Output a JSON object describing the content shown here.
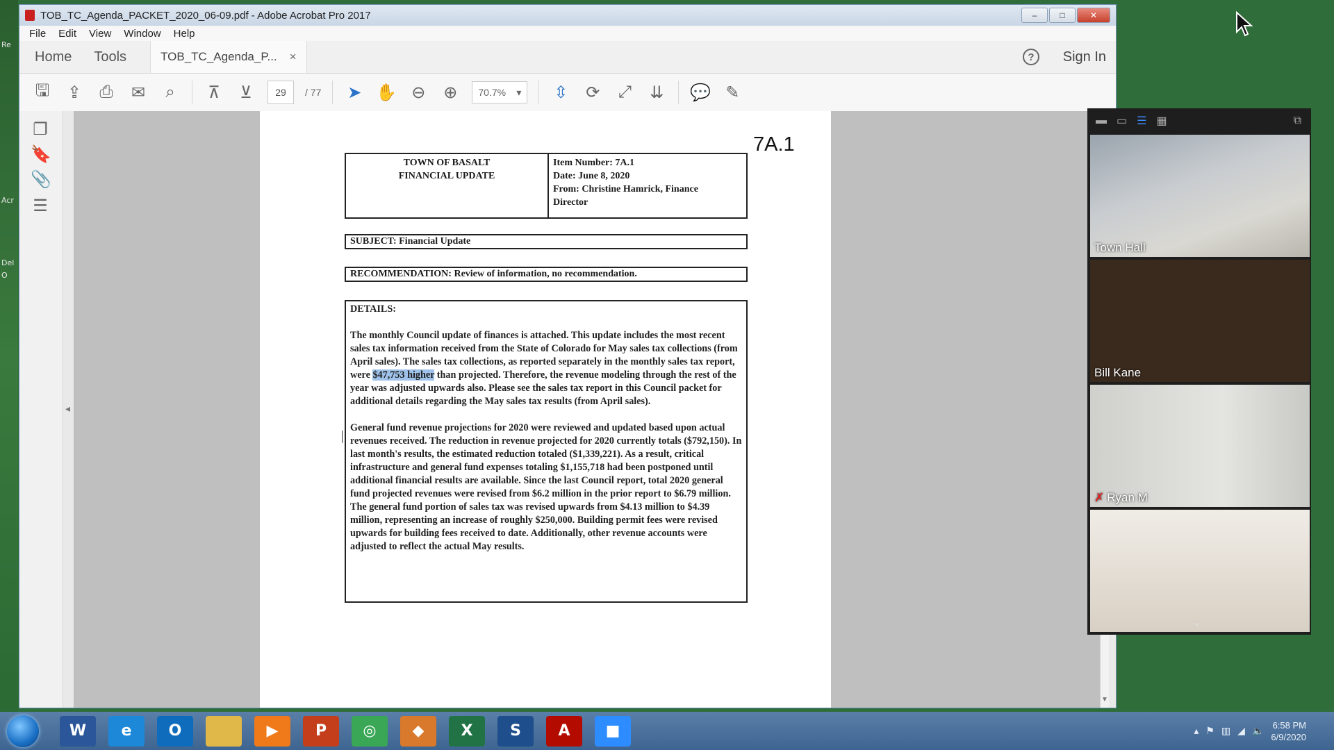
{
  "window": {
    "title": "TOB_TC_Agenda_PACKET_2020_06-09.pdf - Adobe Acrobat Pro 2017"
  },
  "menu": [
    "File",
    "Edit",
    "View",
    "Window",
    "Help"
  ],
  "tabs": {
    "home": "Home",
    "tools": "Tools",
    "doc": "TOB_TC_Agenda_P...",
    "close": "×",
    "signin": "Sign In",
    "help": "?"
  },
  "toolbar": {
    "page_current": "29",
    "page_total": "/ 77",
    "zoom": "70.7%"
  },
  "document": {
    "item_code": "7A.1",
    "header_left": [
      "TOWN OF BASALT",
      "FINANCIAL UPDATE"
    ],
    "header_right": [
      "Item Number:   7A.1",
      "Date: June 8, 2020",
      "From: Christine Hamrick, Finance",
      "Director"
    ],
    "subject": "SUBJECT: Financial Update",
    "recommendation": "RECOMMENDATION:  Review of information, no recommendation.",
    "details_label": "DETAILS:",
    "para1_pre": "The monthly Council update of finances is attached.  This update includes the most recent sales tax information received from the State of Colorado for May sales tax collections (from April sales).  The sales tax collections, as reported separately in the monthly sales tax report, were ",
    "para1_highlight": "$47,753 higher",
    "para1_post": " than projected. Therefore, the revenue modeling through the rest of the year was adjusted upwards also.  Please see the sales tax report in this Council packet for additional details regarding the May sales tax results (from April sales).",
    "para2": "General fund revenue projections for 2020 were reviewed and updated based upon actual revenues received.  The reduction in revenue projected for 2020 currently totals ($792,150).  In last month's results, the estimated reduction totaled ($1,339,221).  As a result, critical infrastructure and general fund expenses totaling $1,155,718 had been postponed until additional financial results are available.  Since the last Council report, total 2020 general fund projected revenues were revised from $6.2 million in the prior report to $6.79 million.  The general fund portion of sales tax was revised upwards from $4.13 million to $4.39 million, representing an increase of roughly $250,000.  Building permit fees were revised upwards for building fees received to date.  Additionally, other revenue accounts were adjusted to reflect the actual May results."
  },
  "participants": [
    {
      "name": "Town Hall",
      "muted": false
    },
    {
      "name": "Bill Kane",
      "muted": false
    },
    {
      "name": "Ryan M",
      "muted": true
    },
    {
      "name": "",
      "muted": false
    }
  ],
  "taskbar": {
    "apps": [
      {
        "icon": "word-icon",
        "label": "W",
        "color": "#2b579a"
      },
      {
        "icon": "ie-icon",
        "label": "e",
        "color": "#1e88d8"
      },
      {
        "icon": "outlook-icon",
        "label": "O",
        "color": "#0f6cbd"
      },
      {
        "icon": "folder-icon",
        "label": "",
        "color": "#e0b84a"
      },
      {
        "icon": "media-player-icon",
        "label": "▶",
        "color": "#f07a1a"
      },
      {
        "icon": "powerpoint-icon",
        "label": "P",
        "color": "#c43e1c"
      },
      {
        "icon": "chrome-icon",
        "label": "◎",
        "color": "#3aa757"
      },
      {
        "icon": "app-diamond-icon",
        "label": "◆",
        "color": "#d9792b"
      },
      {
        "icon": "excel-icon",
        "label": "X",
        "color": "#217346"
      },
      {
        "icon": "s-app-icon",
        "label": "S",
        "color": "#1f4e8c"
      },
      {
        "icon": "acrobat-icon",
        "label": "A",
        "color": "#b30b00"
      },
      {
        "icon": "zoom-icon",
        "label": "■",
        "color": "#2d8cff"
      }
    ],
    "time": "6:58 PM",
    "date": "6/9/2020"
  },
  "desktop_labels": [
    "Re",
    "Acr",
    "Del",
    "O"
  ]
}
